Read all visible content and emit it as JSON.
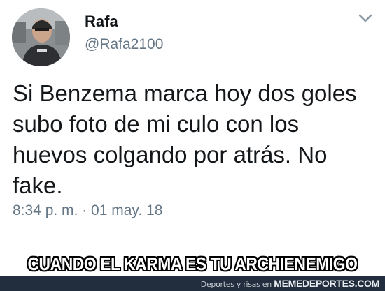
{
  "tweet": {
    "author_name": "Rafa",
    "author_handle": "@Rafa2100",
    "text": "Si Benzema marca hoy dos goles subo foto de mi culo con los huevos colgando por atrás. No fake.",
    "timestamp": "8:34 p. m. · 01 may. 18",
    "menu_icon": "chevron-down-icon"
  },
  "meme": {
    "caption": "CUANDO EL KARMA ES TU ARCHIENEMIGO",
    "footer_prefix": "Deportes y risas en",
    "footer_brand": "MEMEDEPORTES.COM"
  },
  "colors": {
    "text": "#14171a",
    "secondary": "#657786",
    "footer_bg": "#222d3d"
  }
}
